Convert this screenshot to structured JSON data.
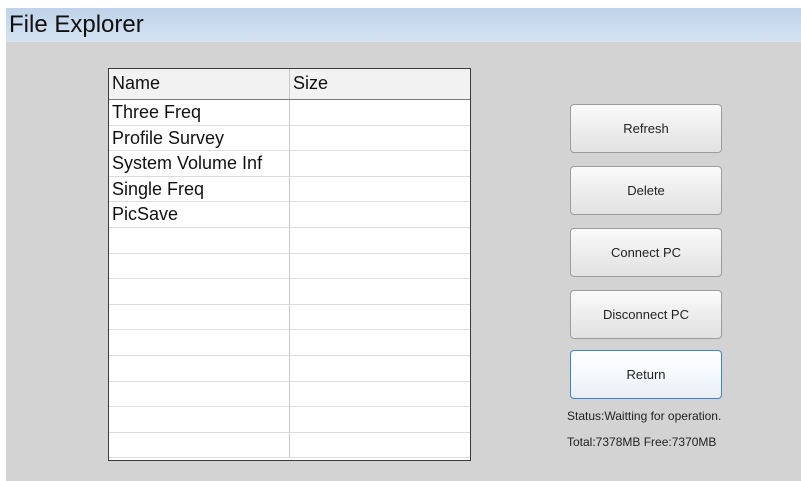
{
  "window": {
    "title": "File Explorer"
  },
  "table": {
    "headers": [
      "Name",
      "Size"
    ],
    "rows": [
      [
        "Three Freq",
        ""
      ],
      [
        "Profile Survey",
        ""
      ],
      [
        "System Volume Inf",
        ""
      ],
      [
        "Single Freq",
        ""
      ],
      [
        "PicSave",
        ""
      ],
      [
        "",
        ""
      ],
      [
        "",
        ""
      ],
      [
        "",
        ""
      ],
      [
        "",
        ""
      ],
      [
        "",
        ""
      ],
      [
        "",
        ""
      ],
      [
        "",
        ""
      ],
      [
        "",
        ""
      ],
      [
        "",
        ""
      ]
    ]
  },
  "buttons": {
    "refresh": "Refresh",
    "delete": "Delete",
    "connect_pc": "Connect PC",
    "disconnect_pc": "Disconnect PC",
    "return": "Return"
  },
  "status": {
    "line": "Status:Waitting for operation.",
    "storage": "Total:7378MB Free:7370MB"
  },
  "colors": {
    "titlebar": "#c9daee",
    "background": "#d3d3d3",
    "focus_border": "#3f82c8"
  }
}
